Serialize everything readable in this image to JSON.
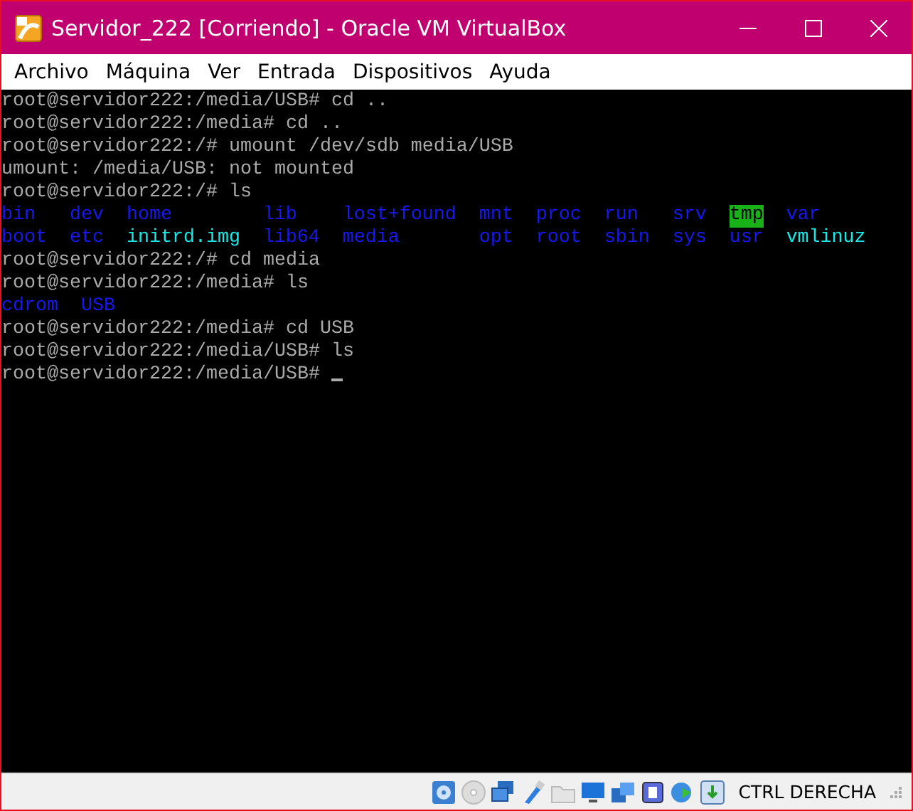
{
  "window": {
    "title": "Servidor_222 [Corriendo] - Oracle VM VirtualBox"
  },
  "menu": [
    "Archivo",
    "Máquina",
    "Ver",
    "Entrada",
    "Dispositivos",
    "Ayuda"
  ],
  "terminal": {
    "lines": [
      {
        "kind": "text",
        "text": "root@servidor222:/media/USB# cd .."
      },
      {
        "kind": "text",
        "text": "root@servidor222:/media# cd .."
      },
      {
        "kind": "text",
        "text": "root@servidor222:/# umount /dev/sdb media/USB"
      },
      {
        "kind": "text",
        "text": "umount: /media/USB: not mounted"
      },
      {
        "kind": "text",
        "text": "root@servidor222:/# ls"
      },
      {
        "kind": "listing",
        "entries": [
          {
            "name": "bin",
            "kind": "dir"
          },
          {
            "name": "dev",
            "kind": "dir"
          },
          {
            "name": "home",
            "kind": "dir"
          },
          {
            "name": "lib",
            "kind": "dir"
          },
          {
            "name": "lost+found",
            "kind": "dir"
          },
          {
            "name": "mnt",
            "kind": "dir"
          },
          {
            "name": "proc",
            "kind": "dir"
          },
          {
            "name": "run",
            "kind": "dir"
          },
          {
            "name": "srv",
            "kind": "dir"
          },
          {
            "name": "tmp",
            "kind": "sticky"
          },
          {
            "name": "var",
            "kind": "dir"
          }
        ]
      },
      {
        "kind": "listing",
        "entries": [
          {
            "name": "boot",
            "kind": "dir"
          },
          {
            "name": "etc",
            "kind": "dir"
          },
          {
            "name": "initrd.img",
            "kind": "link"
          },
          {
            "name": "lib64",
            "kind": "dir"
          },
          {
            "name": "media",
            "kind": "dir"
          },
          {
            "name": "opt",
            "kind": "dir"
          },
          {
            "name": "root",
            "kind": "dir"
          },
          {
            "name": "sbin",
            "kind": "dir"
          },
          {
            "name": "sys",
            "kind": "dir"
          },
          {
            "name": "usr",
            "kind": "dir"
          },
          {
            "name": "vmlinuz",
            "kind": "link"
          }
        ]
      },
      {
        "kind": "text",
        "text": "root@servidor222:/# cd media"
      },
      {
        "kind": "text",
        "text": "root@servidor222:/media# ls"
      },
      {
        "kind": "listing",
        "entries": [
          {
            "name": "cdrom",
            "kind": "dir"
          },
          {
            "name": "USB",
            "kind": "dir"
          }
        ]
      },
      {
        "kind": "text",
        "text": "root@servidor222:/media# cd USB"
      },
      {
        "kind": "text",
        "text": "root@servidor222:/media/USB# ls"
      },
      {
        "kind": "prompt",
        "text": "root@servidor222:/media/USB# "
      }
    ]
  },
  "status_bar": {
    "host_key": "CTRL DERECHA"
  }
}
